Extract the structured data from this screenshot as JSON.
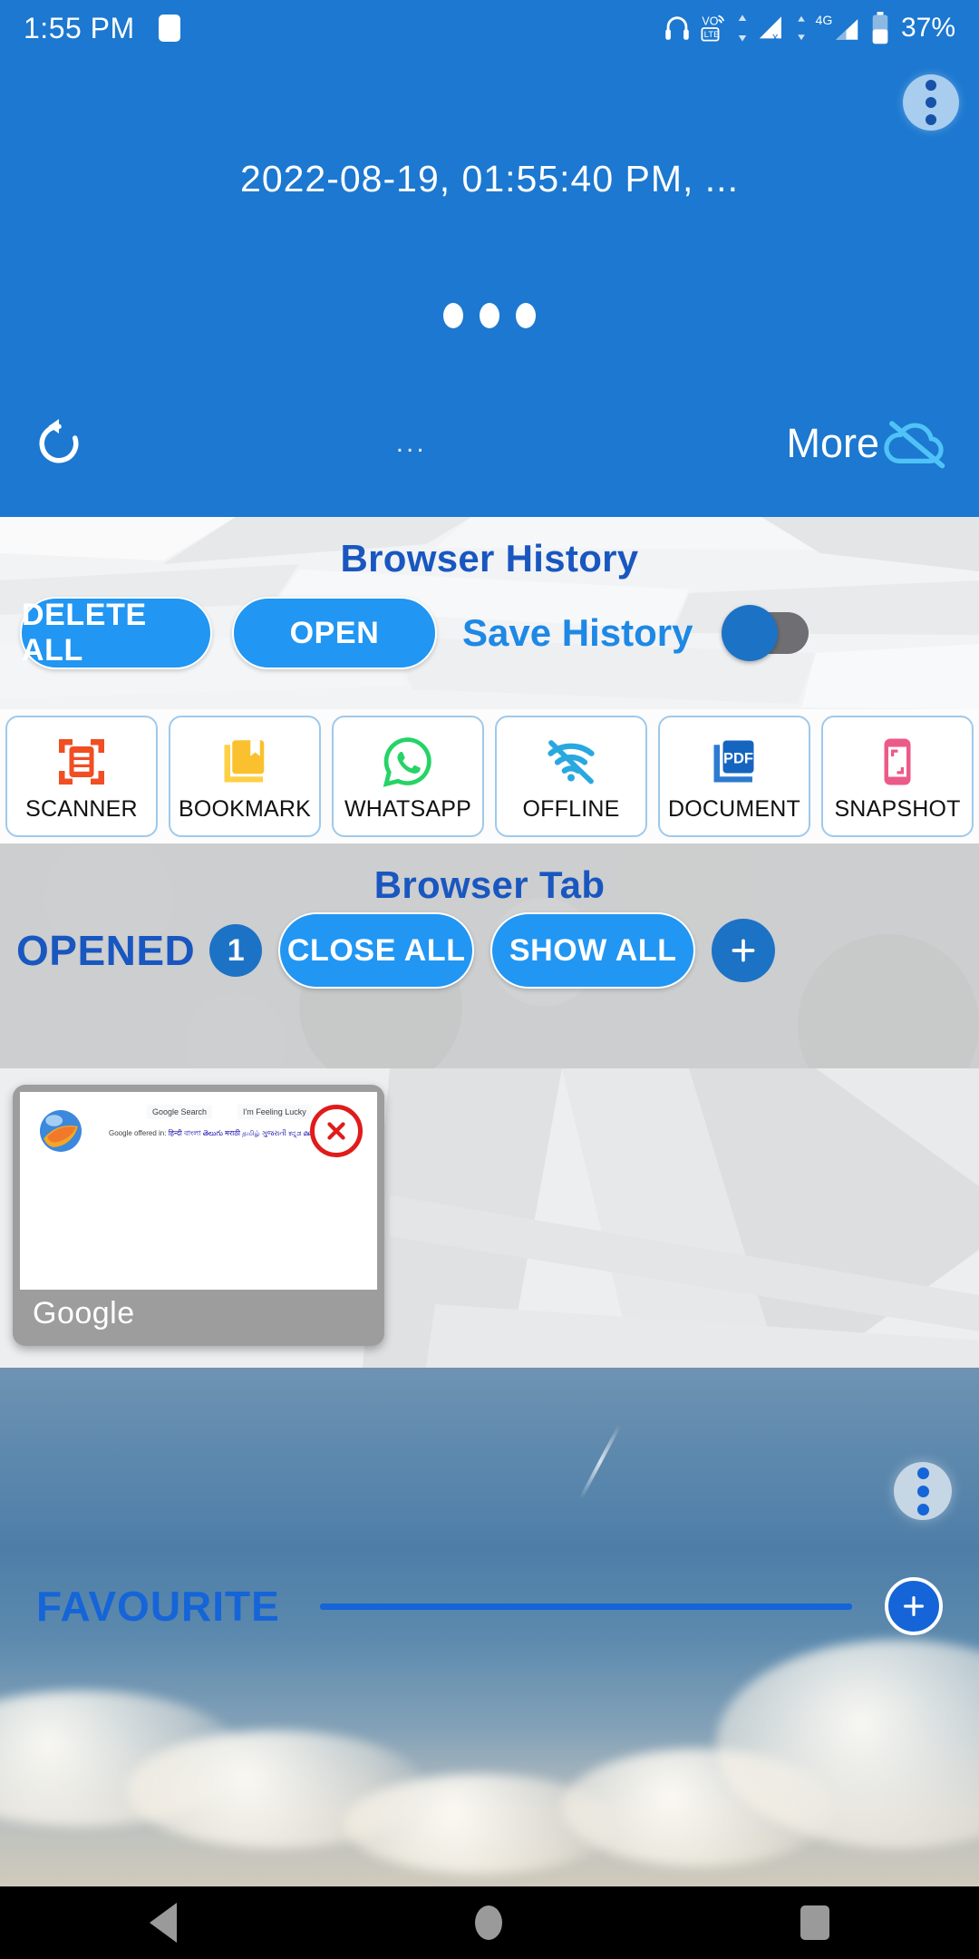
{
  "status_bar": {
    "time": "1:55 PM",
    "battery_percent": "37%",
    "icons": [
      "app-notification-icon",
      "headphones-icon",
      "volte-icon",
      "data-transfer-icon",
      "signal-sim1-icon",
      "4g-icon",
      "signal-sim2-icon",
      "battery-icon"
    ],
    "network_label": "4G",
    "volte_label": "VO",
    "volte_sub_label": "LTE"
  },
  "header": {
    "timestamp_title": "2022-08-19,  01:55:40 PM,  ...",
    "menu_icon": "three-dots-menu-icon",
    "refresh_icon": "refresh-icon",
    "center_ellipsis": "...",
    "more_label": "More",
    "more_icon": "cloud-off-icon",
    "loading_dots": 3,
    "bg_color": "#1C78D0"
  },
  "history": {
    "title": "Browser History",
    "delete_all_label": "DELETE ALL",
    "open_label": "OPEN",
    "save_history_label": "Save History",
    "save_history_on": false,
    "accent_color": "#2196F3",
    "title_color": "#1957C0"
  },
  "tools": [
    {
      "label": "SCANNER",
      "icon": "document-scanner-icon",
      "color": "#F04E23"
    },
    {
      "label": "BOOKMARK",
      "icon": "bookmark-icon",
      "color": "#FBC02D"
    },
    {
      "label": "WHATSAPP",
      "icon": "whatsapp-icon",
      "color": "#25D366"
    },
    {
      "label": "OFFLINE",
      "icon": "wifi-off-icon",
      "color": "#29A8E0"
    },
    {
      "label": "DOCUMENT",
      "icon": "pdf-document-icon",
      "color": "#1565C0"
    },
    {
      "label": "SNAPSHOT",
      "icon": "snapshot-phone-icon",
      "color": "#EC5A87"
    }
  ],
  "browser_tab": {
    "title": "Browser Tab",
    "opened_label": "OPENED",
    "opened_count": "1",
    "close_all_label": "CLOSE ALL",
    "show_all_label": "SHOW ALL",
    "add_tab_icon": "plus-icon",
    "title_color": "#1957C0"
  },
  "tabs": [
    {
      "title": "Google",
      "close_icon": "close-circle-icon",
      "favicon": "browser-globe-icon",
      "page": {
        "search_button": "Google Search",
        "lucky_button": "I'm Feeling Lucky",
        "offered_prefix": "Google offered in:",
        "languages": "हिन्दी  বাংলা  తెలుగు  मराठी  தமிழ்  ગુજરાતી  ಕನ್ನಡ  മലയാളം  ਪੰਜਾਬੀ"
      }
    }
  ],
  "favourite": {
    "label": "FAVOURITE",
    "add_icon": "plus-icon",
    "menu_icon": "three-dots-menu-icon",
    "accent_color": "#1565D8"
  },
  "nav_bar": {
    "back_icon": "back-triangle-icon",
    "home_icon": "home-circle-icon",
    "recents_icon": "recents-square-icon"
  }
}
